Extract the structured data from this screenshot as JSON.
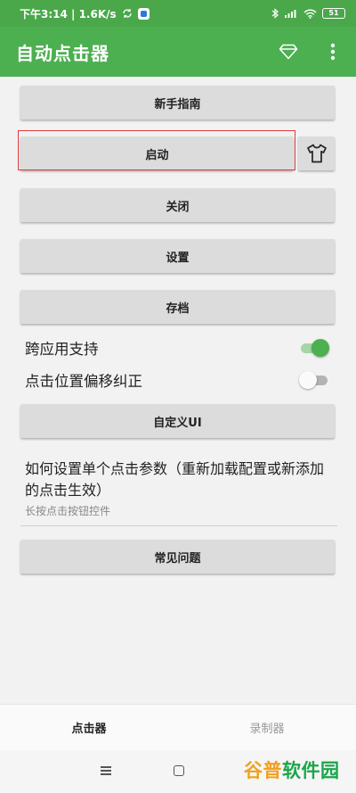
{
  "status_bar": {
    "time_speed": "下午3:14 | 1.6K/s",
    "battery": "51"
  },
  "app_bar": {
    "title": "自动点击器"
  },
  "buttons": {
    "guide": "新手指南",
    "start": "启动",
    "close": "关闭",
    "settings": "设置",
    "archive": "存档",
    "custom_ui": "自定义UI",
    "faq": "常见问题"
  },
  "switches": [
    {
      "label": "跨应用支持",
      "on": true
    },
    {
      "label": "点击位置偏移纠正",
      "on": false
    }
  ],
  "info": {
    "title": "如何设置单个点击参数（重新加载配置或新添加的点击生效）",
    "subtitle": "长按点击按钮控件"
  },
  "bottom_nav": {
    "tabs": [
      {
        "label": "点击器",
        "active": true
      },
      {
        "label": "录制器",
        "active": false
      }
    ]
  },
  "watermark": {
    "part1": "谷普",
    "part2": "软件园"
  },
  "colors": {
    "primary": "#4caf50",
    "status_bar": "#4aa84a",
    "highlight": "#e03a3a"
  }
}
